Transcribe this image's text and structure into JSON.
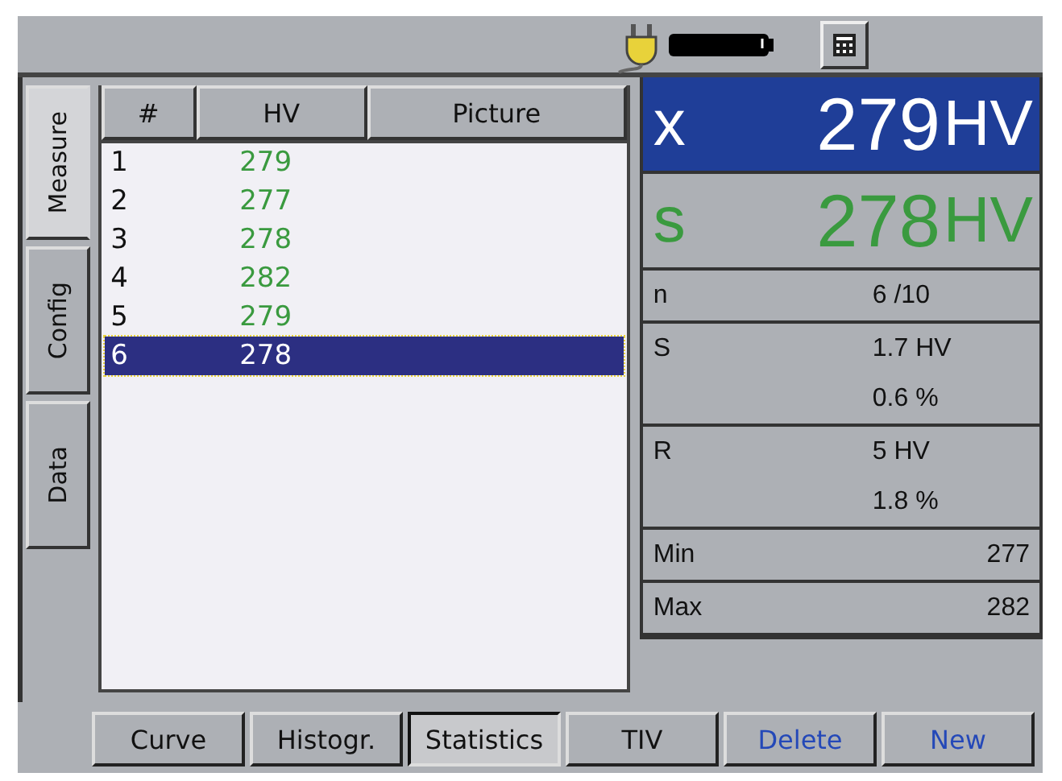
{
  "side_tabs": [
    {
      "label": "Measure",
      "selected": true
    },
    {
      "label": "Config",
      "selected": false
    },
    {
      "label": "Data",
      "selected": false
    }
  ],
  "table": {
    "columns": [
      "#",
      "HV",
      "Picture"
    ],
    "rows": [
      {
        "index": "1",
        "hv": "279",
        "selected": false
      },
      {
        "index": "2",
        "hv": "277",
        "selected": false
      },
      {
        "index": "3",
        "hv": "278",
        "selected": false
      },
      {
        "index": "4",
        "hv": "282",
        "selected": false
      },
      {
        "index": "5",
        "hv": "279",
        "selected": false
      },
      {
        "index": "6",
        "hv": "278",
        "selected": true
      }
    ]
  },
  "summary": [
    {
      "symbol": "x",
      "value": "279",
      "unit": "HV",
      "kind": "mean"
    },
    {
      "symbol": "s",
      "value": "278",
      "unit": "HV",
      "kind": "last"
    }
  ],
  "stats": [
    {
      "label": "n",
      "values": [
        "6 /10"
      ],
      "kind": "center"
    },
    {
      "label": "S",
      "values": [
        "1.7 HV",
        "0.6 %"
      ],
      "kind": "center"
    },
    {
      "label": "R",
      "values": [
        "5 HV",
        "1.8 %"
      ],
      "kind": "center"
    },
    {
      "label": "Min",
      "values": [
        "277"
      ],
      "kind": "right"
    },
    {
      "label": "Max",
      "values": [
        "282"
      ],
      "kind": "right"
    }
  ],
  "buttons": [
    {
      "label": "Curve",
      "kind": "view",
      "selected": false
    },
    {
      "label": "Histogr.",
      "kind": "view",
      "selected": false
    },
    {
      "label": "Statistics",
      "kind": "view",
      "selected": true
    },
    {
      "label": "TIV",
      "kind": "view",
      "selected": false
    },
    {
      "label": "Delete",
      "kind": "action",
      "selected": false
    },
    {
      "label": "New",
      "kind": "action",
      "selected": false
    }
  ]
}
